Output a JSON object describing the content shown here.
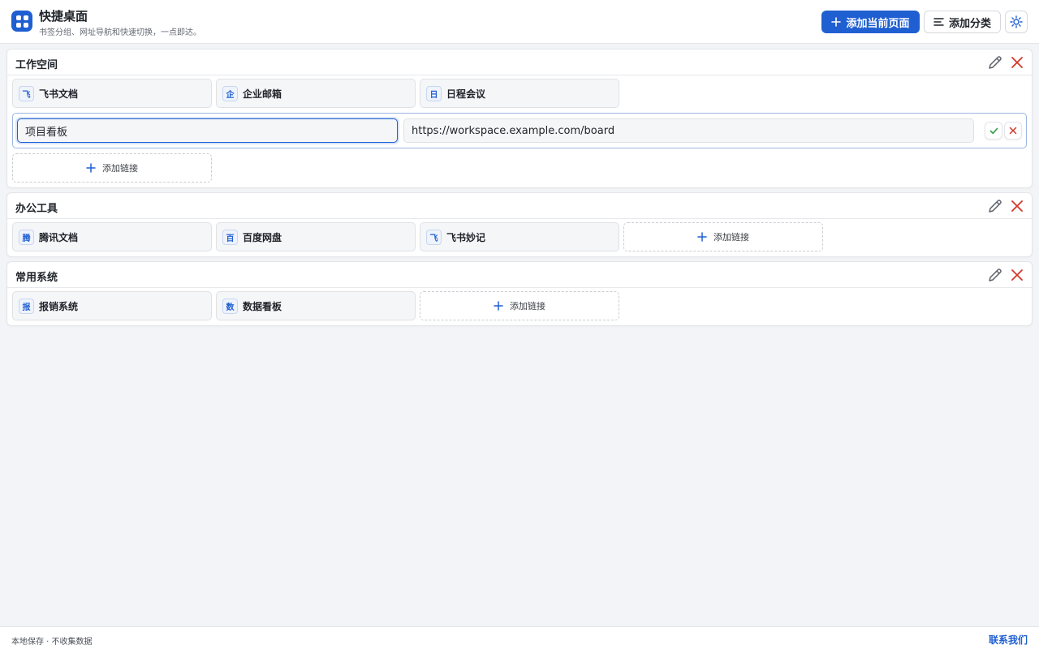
{
  "app": {
    "title": "快捷桌面",
    "subtitle": "书签分组、网址导航和快速切换，一点即达。"
  },
  "toolbar": {
    "add_current_label": "添加当前页面",
    "add_category_label": "添加分类"
  },
  "colors": {
    "primary": "#1f5fd1",
    "danger": "#d0392b",
    "success": "#2f9e44"
  },
  "groups": [
    {
      "title": "工作空间",
      "links": [
        {
          "badge": "飞",
          "name": "飞书文档"
        },
        {
          "badge": "企",
          "name": "企业邮箱"
        },
        {
          "badge": "日",
          "name": "日程会议"
        }
      ],
      "editing": {
        "name_value": "项目看板",
        "url_value": "https://workspace.example.com/board"
      },
      "add_label": "添加链接"
    },
    {
      "title": "办公工具",
      "links": [
        {
          "badge": "腾",
          "name": "腾讯文档"
        },
        {
          "badge": "百",
          "name": "百度网盘"
        },
        {
          "badge": "飞",
          "name": "飞书妙记"
        }
      ],
      "add_label": "添加链接"
    },
    {
      "title": "常用系统",
      "links": [
        {
          "badge": "报",
          "name": "报销系统"
        },
        {
          "badge": "数",
          "name": "数据看板"
        }
      ],
      "add_label": "添加链接"
    }
  ],
  "footer": {
    "note": "本地保存 · 不收集数据",
    "contact_label": "联系我们"
  }
}
